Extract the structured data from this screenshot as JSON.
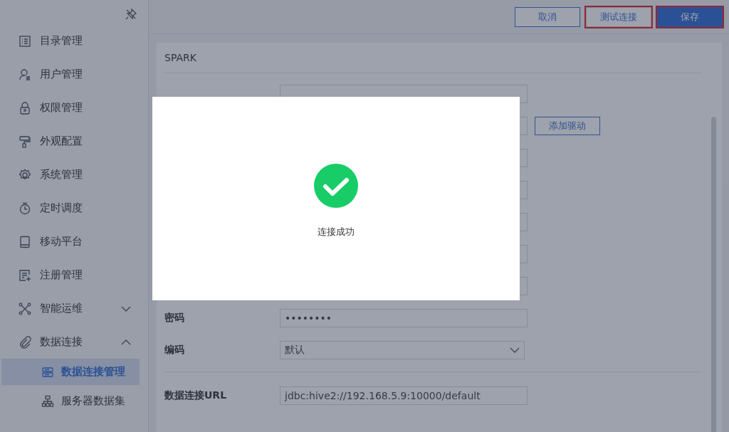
{
  "sidebar": {
    "items": [
      {
        "label": "目录管理",
        "selected": false
      },
      {
        "label": "用户管理",
        "selected": false
      },
      {
        "label": "权限管理",
        "selected": false
      },
      {
        "label": "外观配置",
        "selected": false
      },
      {
        "label": "系统管理",
        "selected": false
      },
      {
        "label": "定时调度",
        "selected": false
      },
      {
        "label": "移动平台",
        "selected": false
      },
      {
        "label": "注册管理",
        "selected": false
      },
      {
        "label": "智能运维",
        "selected": false,
        "expanded": false
      },
      {
        "label": "数据连接",
        "selected": false,
        "expanded": true,
        "children": [
          {
            "label": "数据连接管理",
            "selected": true
          },
          {
            "label": "服务器数据集",
            "selected": false
          }
        ]
      }
    ]
  },
  "toolbar": {
    "buttons": [
      {
        "label": "取消",
        "kind": "outline",
        "highlighted": false
      },
      {
        "label": "测试连接",
        "kind": "plain",
        "highlighted": true
      },
      {
        "label": "保存",
        "kind": "primary",
        "highlighted": true
      }
    ]
  },
  "panel": {
    "title": "SPARK",
    "fields": [
      {
        "kind": "text"
      },
      {
        "kind": "text",
        "action": "添加驱动"
      },
      {
        "kind": "text"
      },
      {
        "kind": "text"
      },
      {
        "kind": "text"
      },
      {
        "kind": "text"
      },
      {
        "kind": "text"
      },
      {
        "kind": "password",
        "label": "密码",
        "value": "••••••••"
      },
      {
        "kind": "select",
        "label": "编码",
        "value": "默认"
      },
      {
        "kind": "divider"
      },
      {
        "kind": "text",
        "label": "数据连接URL",
        "value": "jdbc:hive2://192.168.5.9:10000/default"
      }
    ]
  },
  "dialog": {
    "message": "连接成功"
  }
}
